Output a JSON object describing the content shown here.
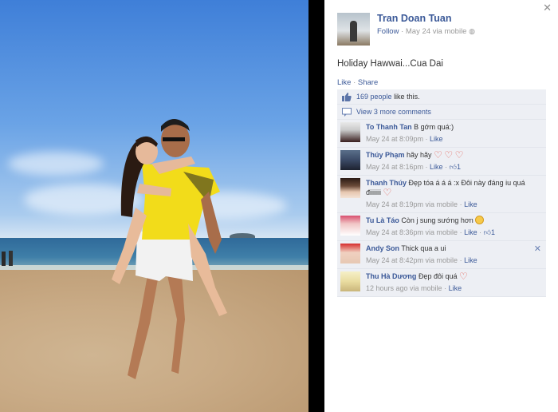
{
  "post": {
    "author": "Tran Doan Tuan",
    "follow_label": "Follow",
    "meta": "· May 24 via mobile",
    "caption": "Holiday Hawwai...Cua Dai",
    "like_action": "Like",
    "share_action": "Share",
    "likes_count_link": "169 people",
    "likes_suffix": "like this.",
    "view_more_comments": "View 3 more comments"
  },
  "comments": [
    {
      "name": "To Thanh Tan",
      "text": "B gớm quá:)",
      "time": "May 24 at 8:09pm",
      "like_label": "Like",
      "like_count": ""
    },
    {
      "name": "Thúy Phạm",
      "text": "hãy hãy",
      "time": "May 24 at 8:16pm",
      "like_label": "Like",
      "like_count": "1"
    },
    {
      "name": "Thanh Thúy",
      "text": "Đẹp tóa á á á :x Đôi này đáng iu quá điiiiiii",
      "time": "May 24 at 8:19pm via mobile",
      "like_label": "Like",
      "like_count": ""
    },
    {
      "name": "Tu Là Táo",
      "text": "Còn j sung sướng hơn",
      "time": "May 24 at 8:36pm via mobile",
      "like_label": "Like",
      "like_count": "1"
    },
    {
      "name": "Andy Son",
      "text": "Thick qua a ui",
      "time": "May 24 at 8:42pm via mobile",
      "like_label": "Like",
      "like_count": ""
    },
    {
      "name": "Thu Hà Dương",
      "text": "Đẹp đôi quá",
      "time": "12 hours ago via mobile",
      "like_label": "Like",
      "like_count": ""
    }
  ],
  "colors": {
    "link": "#3b5998",
    "ufi_bg": "#edeff4",
    "heart": "#e2594e"
  },
  "icons": {
    "close": "close-icon",
    "globe": "globe-icon",
    "thumb": "thumbs-up-icon",
    "comment": "comment-icon"
  }
}
